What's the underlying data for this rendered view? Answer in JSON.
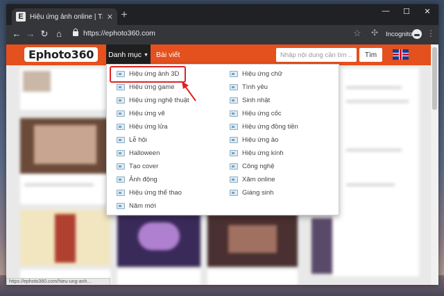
{
  "browser": {
    "tab": {
      "favicon": "E",
      "title": "Hiệu ứng ảnh online | Tạo hiệu ứ"
    },
    "url": "https://ephoto360.com",
    "incognito_label": "Incognito",
    "status_text": "https://ephoto360.com/hieu-ung-anh..."
  },
  "site": {
    "logo": "Ephoto360",
    "nav": {
      "categories": "Danh mục",
      "articles": "Bài viết"
    },
    "search": {
      "placeholder": "Nhập nội dung cần tìm ...",
      "button": "Tìm"
    },
    "colors": {
      "header": "#e4501e",
      "highlight": "#e02020"
    }
  },
  "dropdown": {
    "col1": [
      "Hiệu ứng ảnh 3D",
      "Hiệu ứng game",
      "Hiệu ứng nghệ thuật",
      "Hiệu ứng vẽ",
      "Hiệu ứng lửa",
      "Lễ hội",
      "Halloween",
      "Tạo cover",
      "Ảnh động",
      "Hiệu ứng thể thao",
      "Năm mới"
    ],
    "col2": [
      "Hiệu ứng chữ",
      "Tình yêu",
      "Sinh nhật",
      "Hiệu ứng cốc",
      "Hiệu ứng đồng tiền",
      "Hiệu ứng ảo",
      "Hiệu ứng kính",
      "Công nghệ",
      "Xăm online",
      "Giáng sinh"
    ]
  }
}
